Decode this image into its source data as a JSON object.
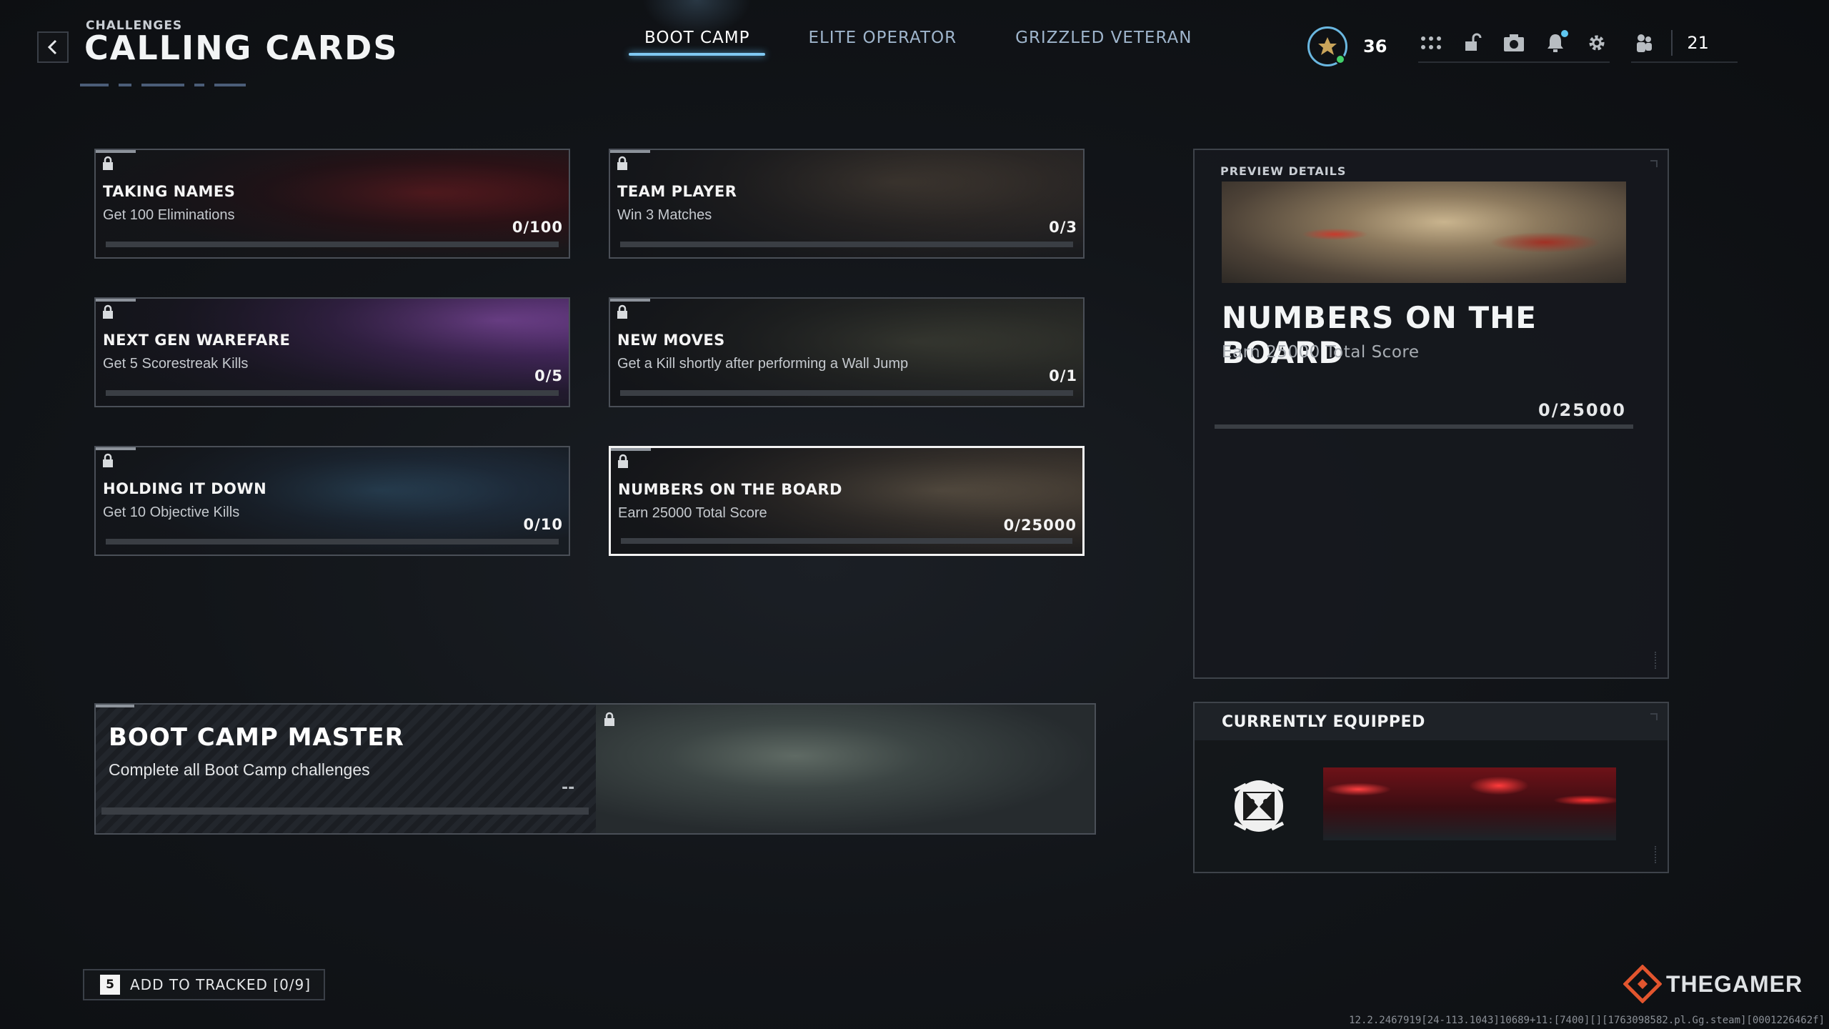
{
  "header": {
    "breadcrumb": "CHALLENGES",
    "title": "CALLING CARDS",
    "back_icon": "chevron-left-icon"
  },
  "tabs": [
    {
      "label": "BOOT CAMP",
      "active": true
    },
    {
      "label": "ELITE OPERATOR",
      "active": false
    },
    {
      "label": "GRIZZLED VETERAN",
      "active": false
    }
  ],
  "topbar": {
    "level": "36",
    "friends_count": "21",
    "icons": [
      "rank-icon",
      "grid-menu-icon",
      "unlock-icon",
      "camera-icon",
      "bell-icon",
      "gear-icon",
      "party-icon"
    ]
  },
  "challenges": [
    {
      "name": "TAKING NAMES",
      "desc": "Get 100 Eliminations",
      "progress": "0/100",
      "locked": true
    },
    {
      "name": "TEAM PLAYER",
      "desc": "Win 3 Matches",
      "progress": "0/3",
      "locked": true
    },
    {
      "name": "NEXT GEN WAREFARE",
      "desc": "Get 5 Scorestreak Kills",
      "progress": "0/5",
      "locked": true
    },
    {
      "name": "NEW MOVES",
      "desc": "Get a Kill shortly after performing a Wall Jump",
      "progress": "0/1",
      "locked": true
    },
    {
      "name": "HOLDING IT DOWN",
      "desc": "Get 10 Objective Kills",
      "progress": "0/10",
      "locked": true
    },
    {
      "name": "NUMBERS ON THE BOARD",
      "desc": "Earn 25000 Total Score",
      "progress": "0/25000",
      "locked": true,
      "selected": true
    }
  ],
  "master": {
    "name": "BOOT CAMP MASTER",
    "desc": "Complete all Boot Camp challenges",
    "progress": "--"
  },
  "preview": {
    "label": "PREVIEW DETAILS",
    "name": "NUMBERS ON THE BOARD",
    "desc": "Earn 25000 Total Score",
    "progress": "0/25000"
  },
  "equipped": {
    "label": "CURRENTLY EQUIPPED"
  },
  "footer": {
    "track_key": "5",
    "track_label": "ADD TO TRACKED [0/9]",
    "watermark": "THEGAMER",
    "build": "12.2.2467919[24-113.1043]10689+11:[7400][][1763098582.pl.Gg.steam][00012264​62f]"
  },
  "colors": {
    "accent": "#7fc8f2",
    "online": "#42d16a",
    "selected_border": "#f3f3f3"
  }
}
